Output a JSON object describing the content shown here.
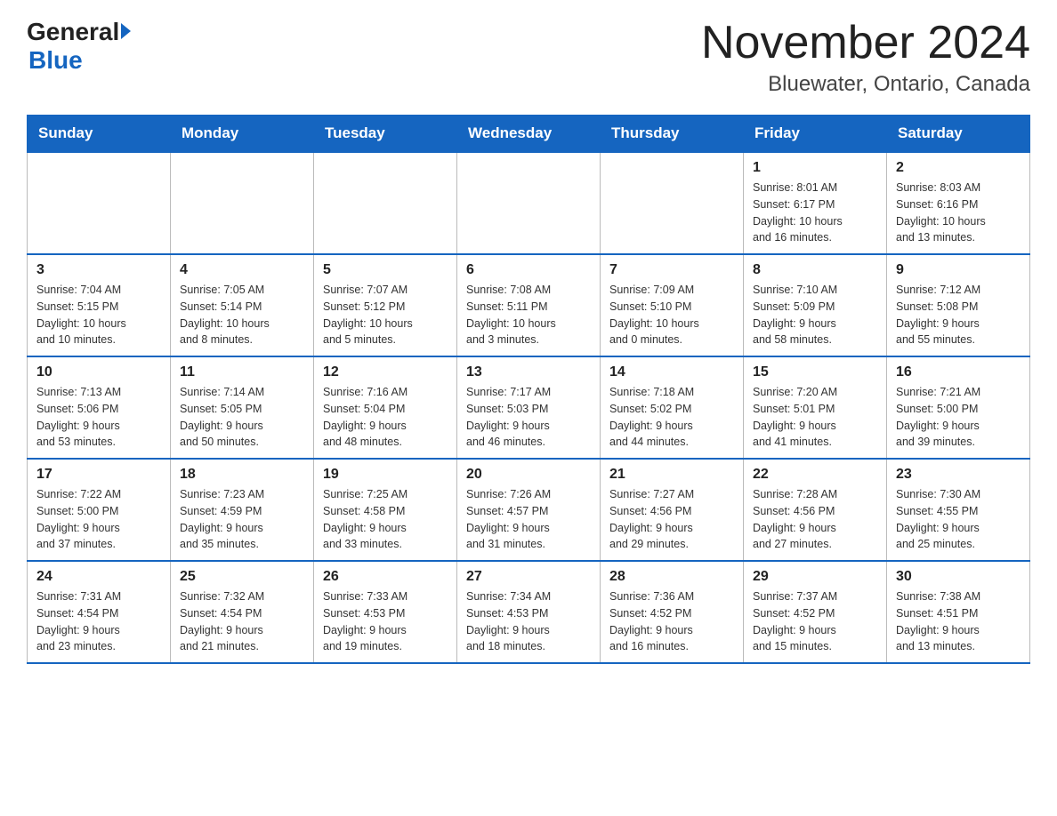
{
  "header": {
    "title": "November 2024",
    "subtitle": "Bluewater, Ontario, Canada",
    "logo_general": "General",
    "logo_blue": "Blue"
  },
  "days_of_week": [
    "Sunday",
    "Monday",
    "Tuesday",
    "Wednesday",
    "Thursday",
    "Friday",
    "Saturday"
  ],
  "weeks": [
    [
      {
        "day": "",
        "info": ""
      },
      {
        "day": "",
        "info": ""
      },
      {
        "day": "",
        "info": ""
      },
      {
        "day": "",
        "info": ""
      },
      {
        "day": "",
        "info": ""
      },
      {
        "day": "1",
        "info": "Sunrise: 8:01 AM\nSunset: 6:17 PM\nDaylight: 10 hours\nand 16 minutes."
      },
      {
        "day": "2",
        "info": "Sunrise: 8:03 AM\nSunset: 6:16 PM\nDaylight: 10 hours\nand 13 minutes."
      }
    ],
    [
      {
        "day": "3",
        "info": "Sunrise: 7:04 AM\nSunset: 5:15 PM\nDaylight: 10 hours\nand 10 minutes."
      },
      {
        "day": "4",
        "info": "Sunrise: 7:05 AM\nSunset: 5:14 PM\nDaylight: 10 hours\nand 8 minutes."
      },
      {
        "day": "5",
        "info": "Sunrise: 7:07 AM\nSunset: 5:12 PM\nDaylight: 10 hours\nand 5 minutes."
      },
      {
        "day": "6",
        "info": "Sunrise: 7:08 AM\nSunset: 5:11 PM\nDaylight: 10 hours\nand 3 minutes."
      },
      {
        "day": "7",
        "info": "Sunrise: 7:09 AM\nSunset: 5:10 PM\nDaylight: 10 hours\nand 0 minutes."
      },
      {
        "day": "8",
        "info": "Sunrise: 7:10 AM\nSunset: 5:09 PM\nDaylight: 9 hours\nand 58 minutes."
      },
      {
        "day": "9",
        "info": "Sunrise: 7:12 AM\nSunset: 5:08 PM\nDaylight: 9 hours\nand 55 minutes."
      }
    ],
    [
      {
        "day": "10",
        "info": "Sunrise: 7:13 AM\nSunset: 5:06 PM\nDaylight: 9 hours\nand 53 minutes."
      },
      {
        "day": "11",
        "info": "Sunrise: 7:14 AM\nSunset: 5:05 PM\nDaylight: 9 hours\nand 50 minutes."
      },
      {
        "day": "12",
        "info": "Sunrise: 7:16 AM\nSunset: 5:04 PM\nDaylight: 9 hours\nand 48 minutes."
      },
      {
        "day": "13",
        "info": "Sunrise: 7:17 AM\nSunset: 5:03 PM\nDaylight: 9 hours\nand 46 minutes."
      },
      {
        "day": "14",
        "info": "Sunrise: 7:18 AM\nSunset: 5:02 PM\nDaylight: 9 hours\nand 44 minutes."
      },
      {
        "day": "15",
        "info": "Sunrise: 7:20 AM\nSunset: 5:01 PM\nDaylight: 9 hours\nand 41 minutes."
      },
      {
        "day": "16",
        "info": "Sunrise: 7:21 AM\nSunset: 5:00 PM\nDaylight: 9 hours\nand 39 minutes."
      }
    ],
    [
      {
        "day": "17",
        "info": "Sunrise: 7:22 AM\nSunset: 5:00 PM\nDaylight: 9 hours\nand 37 minutes."
      },
      {
        "day": "18",
        "info": "Sunrise: 7:23 AM\nSunset: 4:59 PM\nDaylight: 9 hours\nand 35 minutes."
      },
      {
        "day": "19",
        "info": "Sunrise: 7:25 AM\nSunset: 4:58 PM\nDaylight: 9 hours\nand 33 minutes."
      },
      {
        "day": "20",
        "info": "Sunrise: 7:26 AM\nSunset: 4:57 PM\nDaylight: 9 hours\nand 31 minutes."
      },
      {
        "day": "21",
        "info": "Sunrise: 7:27 AM\nSunset: 4:56 PM\nDaylight: 9 hours\nand 29 minutes."
      },
      {
        "day": "22",
        "info": "Sunrise: 7:28 AM\nSunset: 4:56 PM\nDaylight: 9 hours\nand 27 minutes."
      },
      {
        "day": "23",
        "info": "Sunrise: 7:30 AM\nSunset: 4:55 PM\nDaylight: 9 hours\nand 25 minutes."
      }
    ],
    [
      {
        "day": "24",
        "info": "Sunrise: 7:31 AM\nSunset: 4:54 PM\nDaylight: 9 hours\nand 23 minutes."
      },
      {
        "day": "25",
        "info": "Sunrise: 7:32 AM\nSunset: 4:54 PM\nDaylight: 9 hours\nand 21 minutes."
      },
      {
        "day": "26",
        "info": "Sunrise: 7:33 AM\nSunset: 4:53 PM\nDaylight: 9 hours\nand 19 minutes."
      },
      {
        "day": "27",
        "info": "Sunrise: 7:34 AM\nSunset: 4:53 PM\nDaylight: 9 hours\nand 18 minutes."
      },
      {
        "day": "28",
        "info": "Sunrise: 7:36 AM\nSunset: 4:52 PM\nDaylight: 9 hours\nand 16 minutes."
      },
      {
        "day": "29",
        "info": "Sunrise: 7:37 AM\nSunset: 4:52 PM\nDaylight: 9 hours\nand 15 minutes."
      },
      {
        "day": "30",
        "info": "Sunrise: 7:38 AM\nSunset: 4:51 PM\nDaylight: 9 hours\nand 13 minutes."
      }
    ]
  ]
}
